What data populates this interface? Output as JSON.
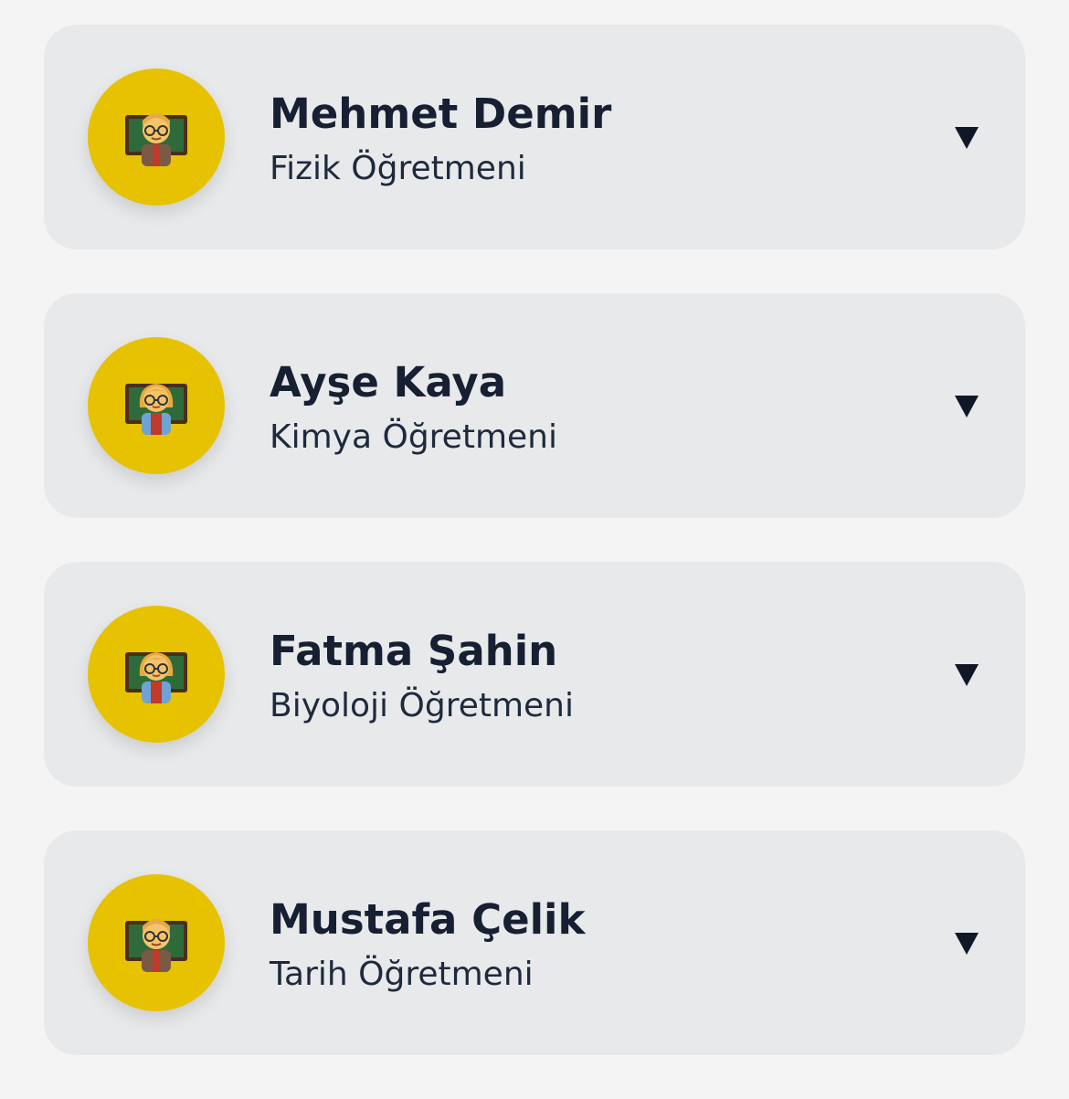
{
  "teachers": [
    {
      "name": "Mehmet Demir",
      "role": "Fizik Öğretmeni",
      "icon": "man-teacher-icon"
    },
    {
      "name": "Ayşe Kaya",
      "role": "Kimya Öğretmeni",
      "icon": "woman-teacher-icon"
    },
    {
      "name": "Fatma Şahin",
      "role": "Biyoloji Öğretmeni",
      "icon": "woman-teacher-icon"
    },
    {
      "name": "Mustafa Çelik",
      "role": "Tarih Öğretmeni",
      "icon": "man-teacher-icon"
    }
  ],
  "colors": {
    "background": "#f4f4f4",
    "card": "#e8e9eb",
    "avatar": "#e6c200",
    "text": "#162032"
  },
  "expand_icon": "caret-down-icon"
}
